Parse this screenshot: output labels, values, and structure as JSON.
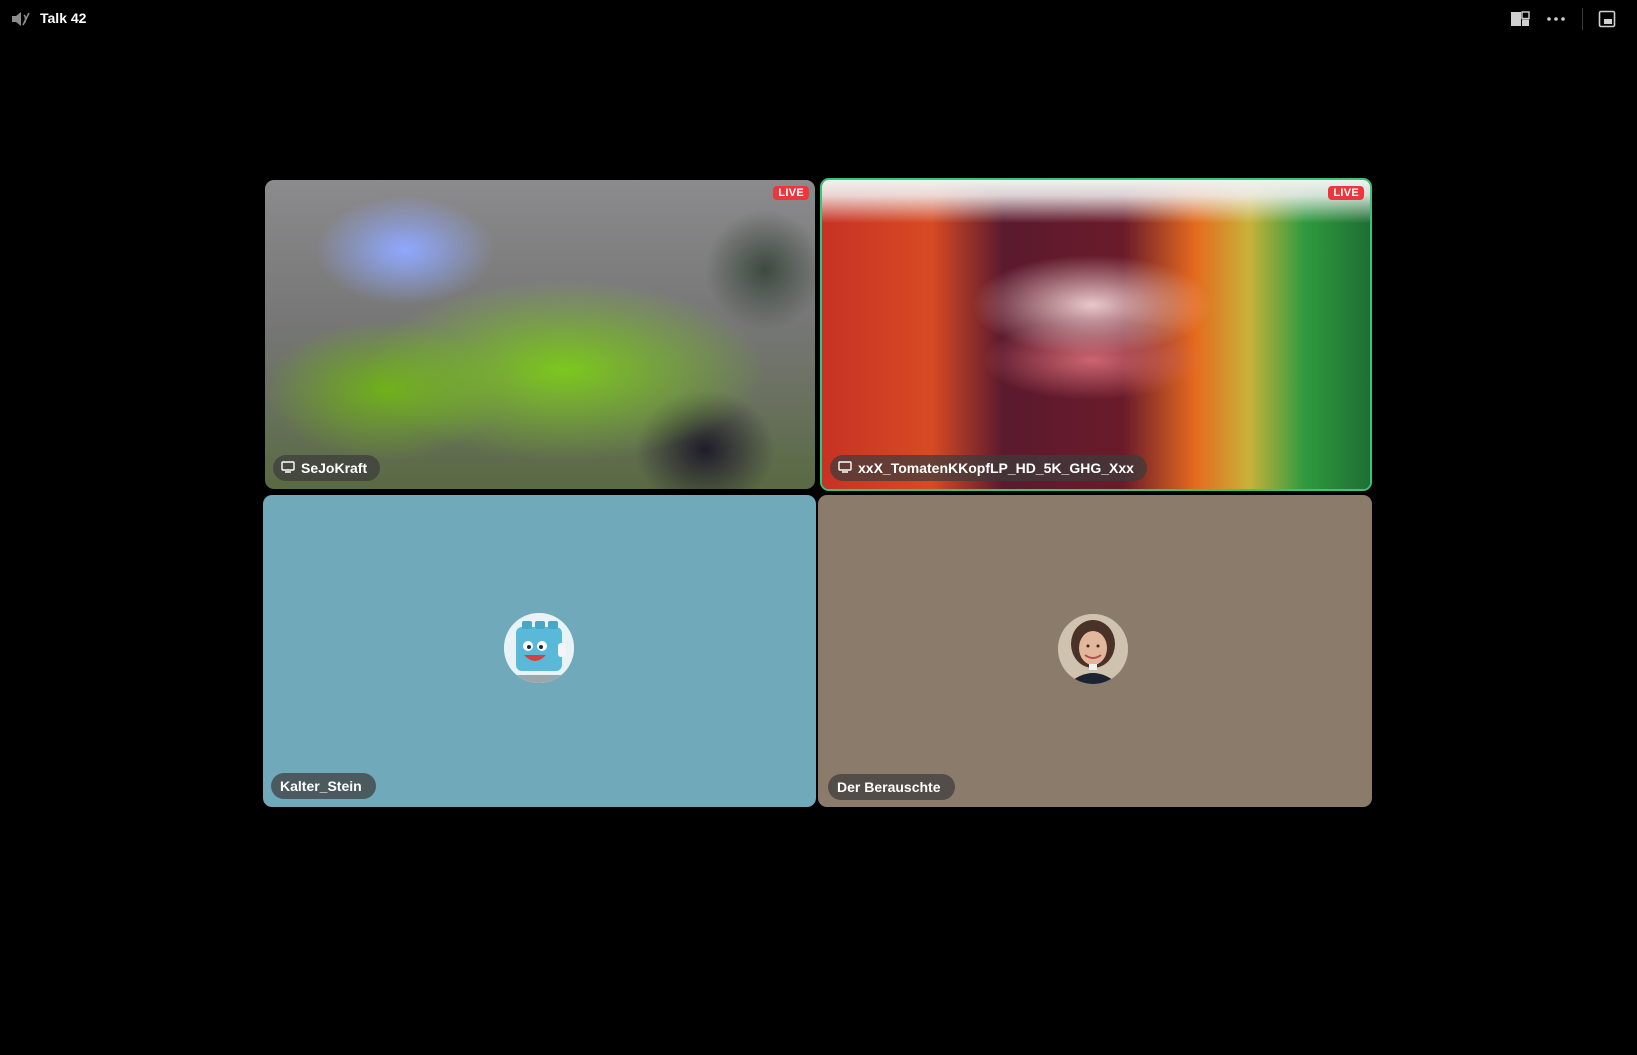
{
  "app": {
    "title": "Talk 42"
  },
  "colors": {
    "background": "#000000",
    "active_speaker_border": "#37c57a",
    "live_badge": "#e9373b",
    "tile_blue": "#70a9ba",
    "tile_brown": "#8b7b6b"
  },
  "toolbar": {
    "icons": [
      "speaker-muted-icon",
      "grid-layout-icon",
      "more-options-icon",
      "popout-window-icon"
    ]
  },
  "tiles": [
    {
      "name": "SeJoKraft",
      "type": "screen-share",
      "live": true,
      "live_label": "LIVE",
      "icon": "monitor-icon"
    },
    {
      "name": "xxX_TomatenKKopfLP_HD_5K_GHG_Xxx",
      "type": "screen-share",
      "live": true,
      "live_label": "LIVE",
      "icon": "monitor-icon",
      "active_speaker": true
    },
    {
      "name": "Kalter_Stein",
      "type": "avatar",
      "background": "#70a9ba",
      "avatar": "lego-brick-mascot"
    },
    {
      "name": "Der Berauschte",
      "type": "avatar",
      "background": "#8b7b6b",
      "avatar": "woman-portrait"
    }
  ]
}
